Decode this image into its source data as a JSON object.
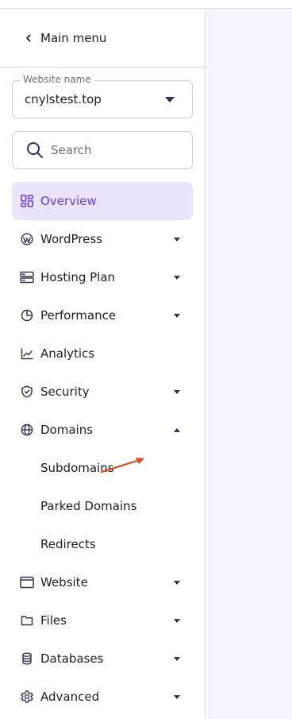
{
  "main_menu": {
    "label": "Main menu",
    "icon": "chevron-left-icon"
  },
  "website_select": {
    "legend": "Website name",
    "value": "cnylstest.top"
  },
  "search": {
    "placeholder": "Search",
    "icon": "search-icon"
  },
  "nav": [
    {
      "label": "Overview",
      "icon": "dashboard-grid-icon",
      "active": true,
      "arrow": "none"
    },
    {
      "label": "WordPress",
      "icon": "wordpress-icon",
      "arrow": "down"
    },
    {
      "label": "Hosting Plan",
      "icon": "server-icon",
      "arrow": "down"
    },
    {
      "label": "Performance",
      "icon": "pie-chart-icon",
      "arrow": "down"
    },
    {
      "label": "Analytics",
      "icon": "trend-chart-icon",
      "arrow": "none"
    },
    {
      "label": "Security",
      "icon": "shield-icon",
      "arrow": "down"
    },
    {
      "label": "Domains",
      "icon": "globe-icon",
      "arrow": "up"
    },
    {
      "label": "Website",
      "icon": "browser-window-icon",
      "arrow": "down"
    },
    {
      "label": "Files",
      "icon": "folder-icon",
      "arrow": "down"
    },
    {
      "label": "Databases",
      "icon": "database-icon",
      "arrow": "down"
    },
    {
      "label": "Advanced",
      "icon": "gear-icon",
      "arrow": "down"
    }
  ],
  "domains_sub": [
    "Subdomains",
    "Parked Domains",
    "Redirects"
  ],
  "colors": {
    "accent": "#673de6",
    "active_bg": "#ebe4ff",
    "text": "#1d1e20",
    "annotation_arrow": "#e5411d"
  }
}
